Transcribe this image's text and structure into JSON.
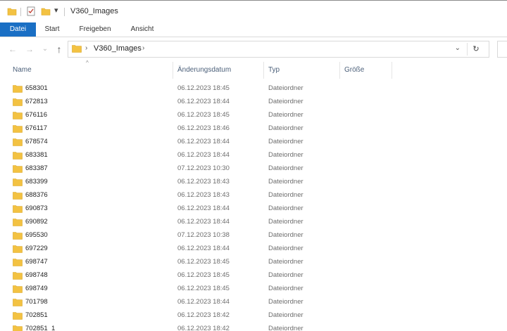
{
  "window": {
    "title": "V360_Images",
    "qa_dropdown_glyph": "▾"
  },
  "ribbon": {
    "tabs": [
      {
        "label": "Datei"
      },
      {
        "label": "Start"
      },
      {
        "label": "Freigeben"
      },
      {
        "label": "Ansicht"
      }
    ]
  },
  "nav": {
    "back_glyph": "←",
    "forward_glyph": "→",
    "recent_glyph": "⌄",
    "up_glyph": "↑",
    "address": {
      "separator": "›",
      "current": "V360_Images",
      "dropdown_glyph": "⌄",
      "refresh_glyph": "↻"
    }
  },
  "columns": {
    "name": "Name",
    "date": "Änderungsdatum",
    "type": "Typ",
    "size": "Größe",
    "sort_glyph": "^"
  },
  "files": [
    {
      "name": "658301",
      "date": "06.12.2023 18:45",
      "type": "Dateiordner",
      "size": ""
    },
    {
      "name": "672813",
      "date": "06.12.2023 18:44",
      "type": "Dateiordner",
      "size": ""
    },
    {
      "name": "676116",
      "date": "06.12.2023 18:45",
      "type": "Dateiordner",
      "size": ""
    },
    {
      "name": "676117",
      "date": "06.12.2023 18:46",
      "type": "Dateiordner",
      "size": ""
    },
    {
      "name": "678574",
      "date": "06.12.2023 18:44",
      "type": "Dateiordner",
      "size": ""
    },
    {
      "name": "683381",
      "date": "06.12.2023 18:44",
      "type": "Dateiordner",
      "size": ""
    },
    {
      "name": "683387",
      "date": "07.12.2023 10:30",
      "type": "Dateiordner",
      "size": ""
    },
    {
      "name": "683399",
      "date": "06.12.2023 18:43",
      "type": "Dateiordner",
      "size": ""
    },
    {
      "name": "688376",
      "date": "06.12.2023 18:43",
      "type": "Dateiordner",
      "size": ""
    },
    {
      "name": "690873",
      "date": "06.12.2023 18:44",
      "type": "Dateiordner",
      "size": ""
    },
    {
      "name": "690892",
      "date": "06.12.2023 18:44",
      "type": "Dateiordner",
      "size": ""
    },
    {
      "name": "695530",
      "date": "07.12.2023 10:38",
      "type": "Dateiordner",
      "size": ""
    },
    {
      "name": "697229",
      "date": "06.12.2023 18:44",
      "type": "Dateiordner",
      "size": ""
    },
    {
      "name": "698747",
      "date": "06.12.2023 18:45",
      "type": "Dateiordner",
      "size": ""
    },
    {
      "name": "698748",
      "date": "06.12.2023 18:45",
      "type": "Dateiordner",
      "size": ""
    },
    {
      "name": "698749",
      "date": "06.12.2023 18:45",
      "type": "Dateiordner",
      "size": ""
    },
    {
      "name": "701798",
      "date": "06.12.2023 18:44",
      "type": "Dateiordner",
      "size": ""
    },
    {
      "name": "702851",
      "date": "06.12.2023 18:42",
      "type": "Dateiordner",
      "size": ""
    },
    {
      "name": "702851_1",
      "date": "06.12.2023 18:42",
      "type": "Dateiordner",
      "size": ""
    }
  ],
  "colors": {
    "accent": "#1a6fc4",
    "folder": "#f3c242",
    "folder_dark": "#dba520"
  },
  "icons": {
    "folder": "folder-icon",
    "up": "up-arrow-icon",
    "refresh": "refresh-icon"
  }
}
